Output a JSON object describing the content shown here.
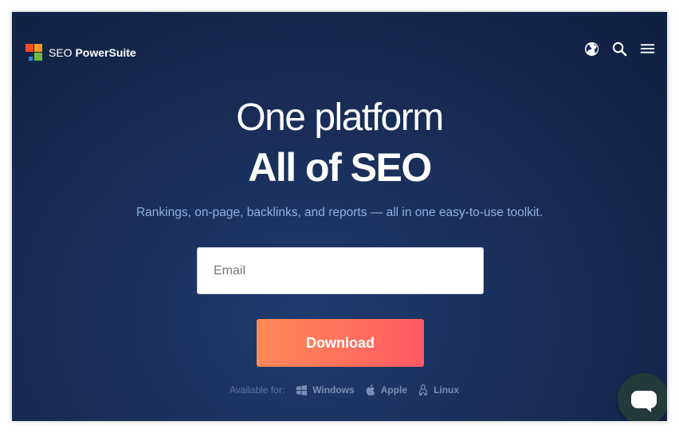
{
  "brand": {
    "name_regular": "SEO",
    "name_bold": "PowerSuite"
  },
  "header": {
    "icons": [
      "globe-icon",
      "search-icon",
      "menu-icon"
    ]
  },
  "hero": {
    "headline_line1": "One platform",
    "headline_line2": "All of SEO",
    "subtitle": "Rankings, on-page, backlinks, and reports — all in one easy-to-use toolkit."
  },
  "form": {
    "email_placeholder": "Email",
    "email_value": "",
    "download_label": "Download"
  },
  "availability": {
    "label": "Available for:",
    "platforms": [
      "Windows",
      "Apple",
      "Linux"
    ]
  },
  "chat": {
    "icon": "chat-icon"
  },
  "colors": {
    "accent_start": "#ff8a55",
    "accent_end": "#ff5a63",
    "hero_bg": "#1a2f5a"
  }
}
